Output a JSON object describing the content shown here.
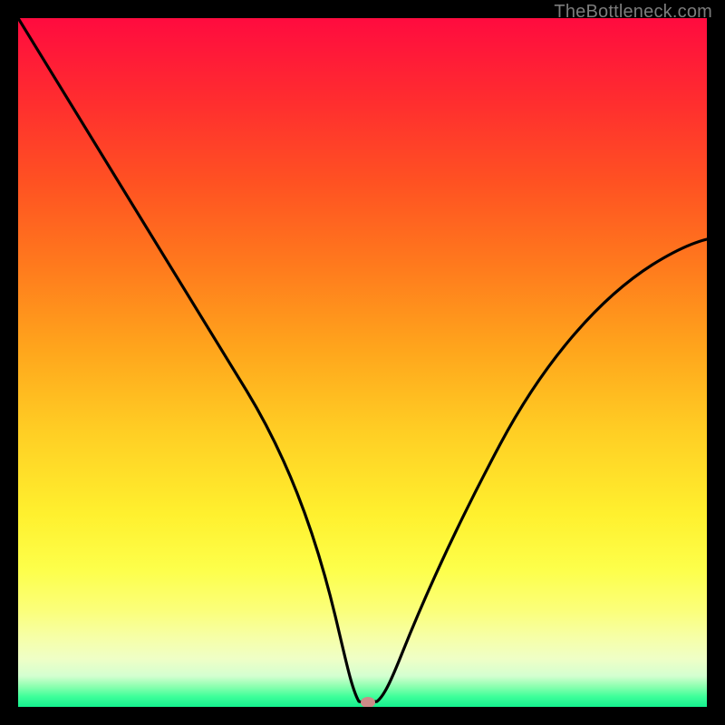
{
  "watermark": "TheBottleneck.com",
  "chart_data": {
    "type": "line",
    "title": "",
    "xlabel": "",
    "ylabel": "",
    "xlim": [
      0,
      100
    ],
    "ylim": [
      0,
      100
    ],
    "grid": false,
    "legend": false,
    "background_gradient": {
      "top": "#ff0b3f",
      "mid": "#fff02e",
      "bottom": "#14f08e"
    },
    "marker": {
      "x": 50.5,
      "y": 0.5,
      "color": "#cc8b88"
    },
    "series": [
      {
        "name": "bottleneck-curve",
        "color": "#000000",
        "x": [
          0,
          5,
          10,
          15,
          20,
          25,
          30,
          33,
          36,
          39,
          42,
          44,
          46,
          48,
          49,
          50,
          51,
          52,
          53,
          55,
          58,
          62,
          66,
          70,
          75,
          80,
          85,
          90,
          95,
          100
        ],
        "y": [
          100,
          91,
          82,
          73,
          64,
          55,
          45,
          39,
          32,
          25,
          18,
          12,
          7,
          3,
          1.2,
          0.5,
          0.5,
          0.5,
          0.8,
          2,
          5,
          10,
          15,
          21,
          29,
          37,
          45,
          52,
          59,
          66
        ]
      }
    ]
  }
}
